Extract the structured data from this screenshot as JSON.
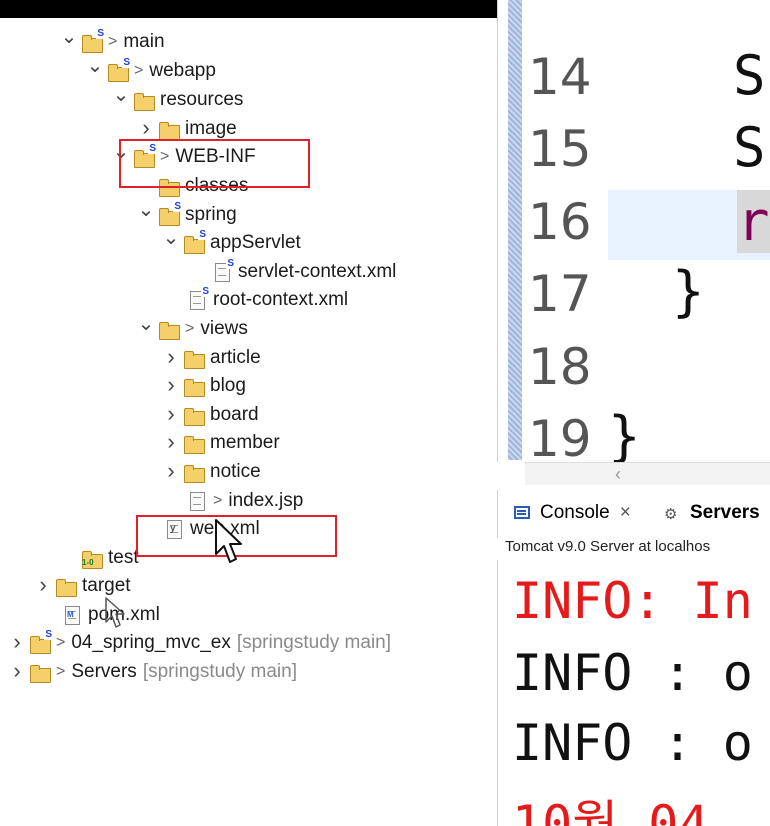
{
  "explorer": {
    "rows": [
      {
        "label": "main"
      },
      {
        "label": "webapp"
      },
      {
        "label": "resources"
      },
      {
        "label": "image"
      },
      {
        "label": "WEB-INF"
      },
      {
        "label": "classes"
      },
      {
        "label": "spring"
      },
      {
        "label": "appServlet"
      },
      {
        "label": "servlet-context.xml"
      },
      {
        "label": "root-context.xml"
      },
      {
        "label": "views"
      },
      {
        "label": "article"
      },
      {
        "label": "blog"
      },
      {
        "label": "board"
      },
      {
        "label": "member"
      },
      {
        "label": "notice"
      },
      {
        "label": "index.jsp"
      },
      {
        "label": "web.xml"
      },
      {
        "label": "test"
      },
      {
        "label": "target"
      },
      {
        "label": "pom.xml"
      },
      {
        "label": "04_spring_mvc_ex",
        "suffix": "[springstudy main]"
      },
      {
        "label": "Servers",
        "suffix": "[springstudy main]"
      }
    ],
    "highlight_color": "#e0202a"
  },
  "editor": {
    "line_numbers": [
      "14",
      "15",
      "16",
      "17",
      "18",
      "19"
    ],
    "code_fragments": [
      "S",
      "S",
      "r",
      "}",
      "}"
    ]
  },
  "console": {
    "tabs": [
      {
        "label": "Console",
        "icon": "console-icon"
      },
      {
        "label": "Servers",
        "icon": "servers-icon"
      }
    ],
    "server_label": "Tomcat v9.0 Server at localhos",
    "log_lines": [
      {
        "text": "INFO: In",
        "level": "error"
      },
      {
        "text": "INFO : o",
        "level": "info"
      },
      {
        "text": "INFO : o",
        "level": "info"
      },
      {
        "text": "10월 04",
        "level": "error"
      }
    ]
  },
  "colors": {
    "log_error": "#e51a1a",
    "folder": "#f4cf6a",
    "spring_badge": "#1f3fd6"
  }
}
